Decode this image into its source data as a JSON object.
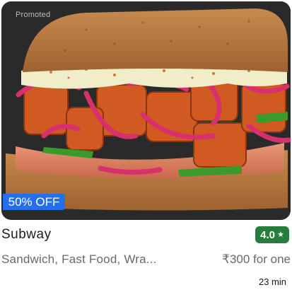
{
  "card": {
    "promoted_label": "Promoted",
    "offer": "50% OFF",
    "restaurant_name": "Subway",
    "rating": "4.0",
    "rating_icon": "star-icon",
    "cuisines": "Sandwich, Fast Food, Wra...",
    "price": "₹300 for one",
    "delivery_time": "23 min",
    "image_subject": "food-image"
  },
  "colors": {
    "offer_badge": "#256fef",
    "rating_badge": "#267e3e",
    "secondary_text": "#696969",
    "primary_text": "#1c1c1c"
  }
}
